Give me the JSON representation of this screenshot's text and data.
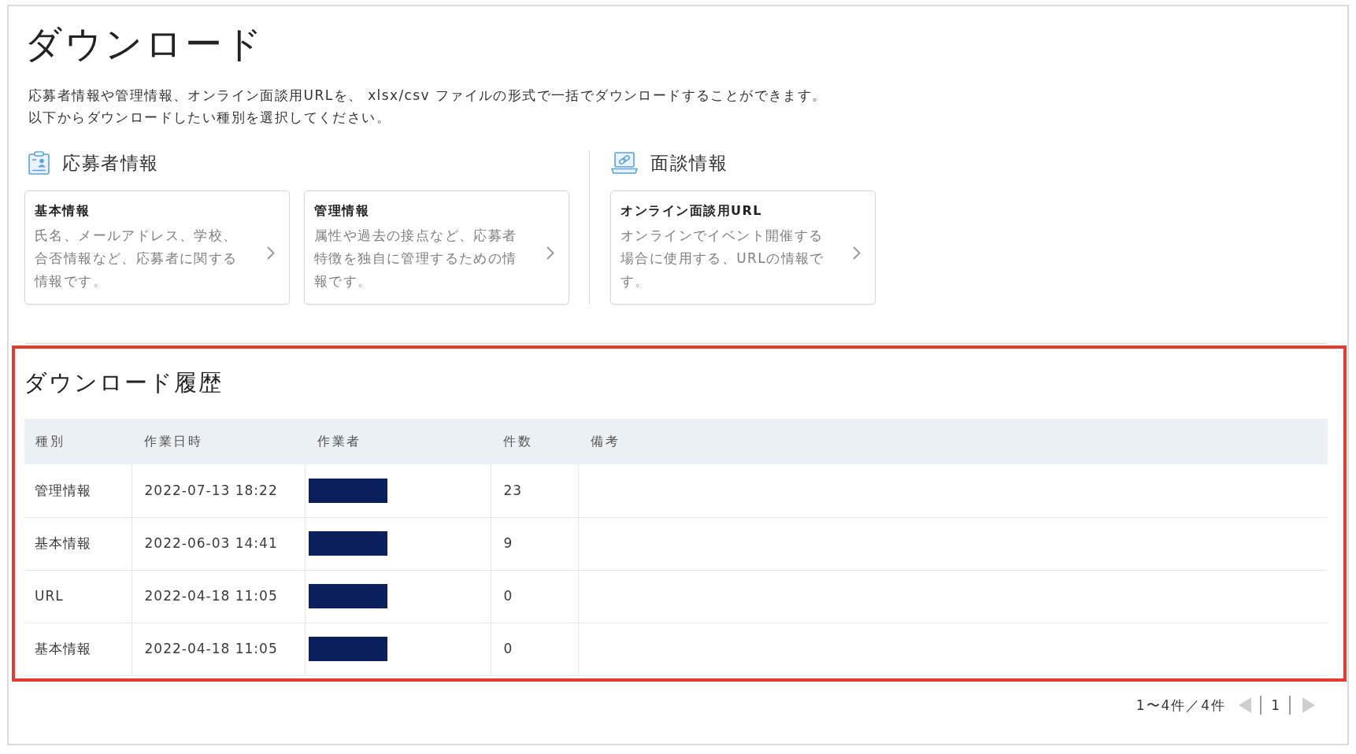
{
  "page": {
    "title": "ダウンロード",
    "description_lines": [
      "応募者情報や管理情報、オンライン面談用URLを、 xlsx/csv ファイルの形式で一括でダウンロードすることができます。",
      "以下からダウンロードしたい種別を選択してください。"
    ]
  },
  "sections": [
    {
      "kind": "applicant",
      "title": "応募者情報",
      "cards": [
        {
          "title": "基本情報",
          "description": "氏名、メールアドレス、学校、合否情報など、応募者に関する情報です。"
        },
        {
          "title": "管理情報",
          "description": "属性や過去の接点など、応募者特徴を独自に管理するための情報です。"
        }
      ]
    },
    {
      "kind": "interview",
      "title": "面談情報",
      "cards": [
        {
          "title": "オンライン面談用URL",
          "description": "オンラインでイベント開催する場合に使用する、URLの情報です。"
        }
      ]
    }
  ],
  "history": {
    "title": "ダウンロード履歴",
    "highlighted": true,
    "columns": [
      "種別",
      "作業日時",
      "作業者",
      "件数",
      "備考"
    ],
    "rows": [
      {
        "type": "管理情報",
        "datetime": "2022-07-13 18:22",
        "operator_redacted": true,
        "count": "23"
      },
      {
        "type": "基本情報",
        "datetime": "2022-06-03 14:41",
        "operator_redacted": true,
        "count": "9"
      },
      {
        "type": "URL",
        "datetime": "2022-04-18 11:05",
        "operator_redacted": true,
        "count": "0"
      },
      {
        "type": "基本情報",
        "datetime": "2022-04-18 11:05",
        "operator_redacted": true,
        "count": "0"
      }
    ]
  },
  "pagination": {
    "summary": "1〜4件／4件",
    "page": "1",
    "prev_disabled": true,
    "next_disabled": true
  }
}
